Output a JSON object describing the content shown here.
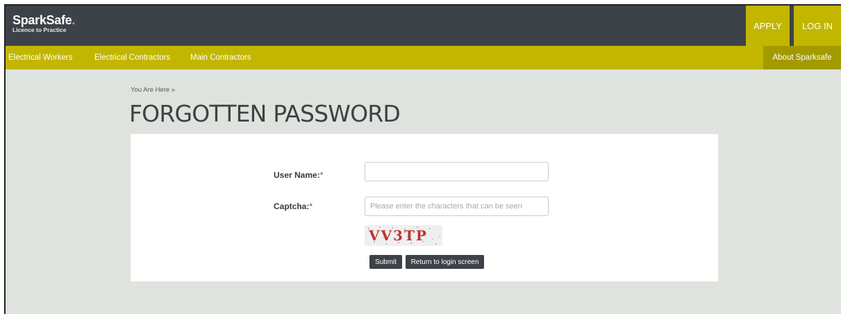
{
  "brand": {
    "name": "SparkSafe",
    "name_dot": ".",
    "tagline": "Licence to Practice"
  },
  "header_buttons": {
    "apply": "APPLY",
    "login": "LOG IN"
  },
  "nav": {
    "items": [
      "Electrical Workers",
      "Electrical Contractors",
      "Main Contractors"
    ],
    "about": "About Sparksafe"
  },
  "breadcrumb": "You Are Here »",
  "page_title": "FORGOTTEN PASSWORD",
  "form": {
    "user_name_label": "User Name:",
    "required_mark": "*",
    "user_name_value": "",
    "captcha_label": "Captcha:",
    "captcha_placeholder": "Please enter the characters that can be seen",
    "captcha_text": "VV3TP",
    "submit_label": "Submit",
    "return_label": "Return to login screen"
  },
  "colors": {
    "header": "#3c4248",
    "accent": "#c2b600",
    "accent_dark": "#a39a00",
    "page_bg": "#dfe3dd",
    "captcha_red": "#c0322e"
  }
}
